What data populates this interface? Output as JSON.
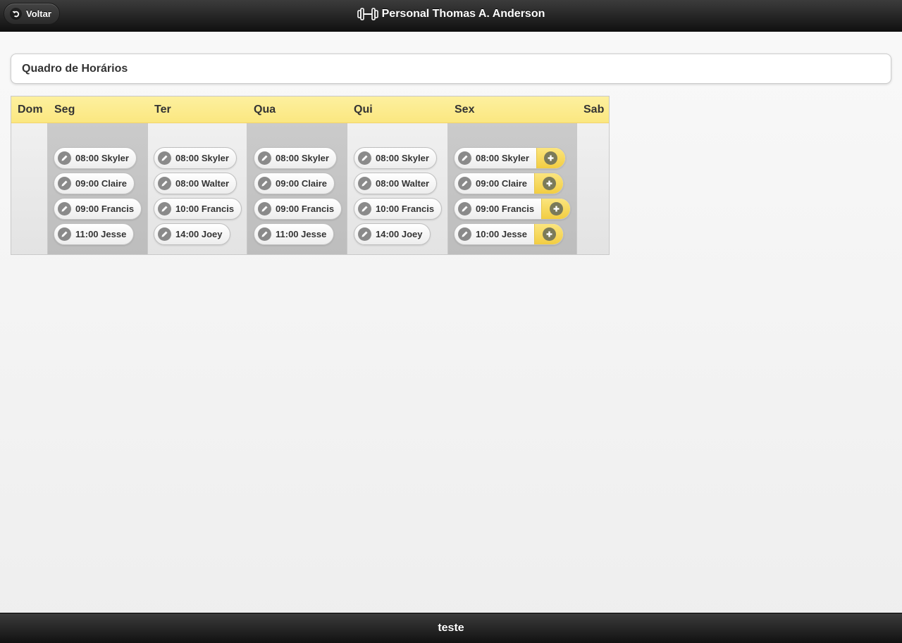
{
  "header": {
    "back_label": "Voltar",
    "title": "Personal Thomas A. Anderson"
  },
  "panel": {
    "title": "Quadro de Horários"
  },
  "schedule": {
    "days": [
      "Dom",
      "Seg",
      "Ter",
      "Qua",
      "Qui",
      "Sex",
      "Sab"
    ],
    "seg": [
      "08:00 Skyler",
      "09:00 Claire",
      "09:00 Francis",
      "11:00 Jesse"
    ],
    "ter": [
      "08:00 Skyler",
      "08:00 Walter",
      "10:00 Francis",
      "14:00 Joey"
    ],
    "qua": [
      "08:00 Skyler",
      "09:00 Claire",
      "09:00 Francis",
      "11:00 Jesse"
    ],
    "qui": [
      "08:00 Skyler",
      "08:00 Walter",
      "10:00 Francis",
      "14:00 Joey"
    ],
    "sex": [
      "08:00 Skyler",
      "09:00 Claire",
      "09:00 Francis",
      "10:00 Jesse"
    ]
  },
  "footer": {
    "text": "teste"
  },
  "colors": {
    "header_bg": "#222222",
    "day_header_bg": "#fbe780",
    "add_button_bg": "#f2cd42"
  },
  "icons": {
    "back": "undo-arrow-icon",
    "logo": "dumbbell-icon",
    "edit": "pencil-icon",
    "add": "plus-icon"
  }
}
